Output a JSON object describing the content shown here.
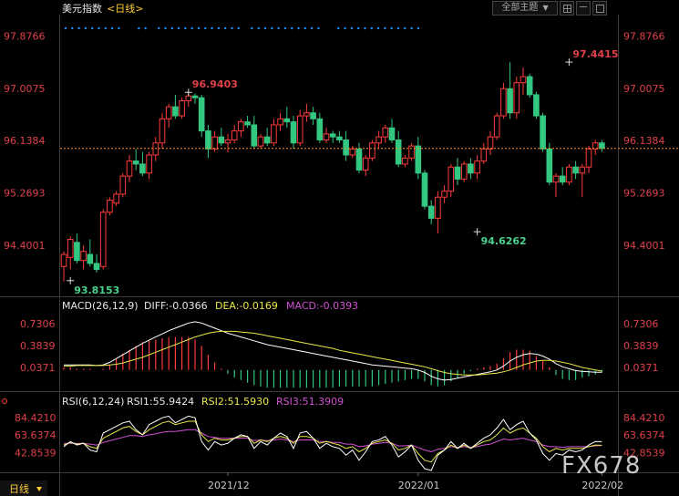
{
  "header": {
    "title": "美元指数",
    "period": "<日线>",
    "dropdown_label": "全部主题",
    "dropdown_arrow": "▼"
  },
  "footer": {
    "period_label": "日线",
    "watermark": "FX678"
  },
  "colors": {
    "up": "#ff3b3b",
    "down": "#32c882",
    "price_label": "#e0404a",
    "diff": "#ffffff",
    "dea": "#e8e84a",
    "macd": "#d050d0",
    "rsi1": "#ffffff",
    "rsi2": "#e8e84a",
    "rsi3": "#d050d0",
    "dots": "#1e90ff",
    "current_line": "#ff9020"
  },
  "chart_data": [
    {
      "type": "candlestick",
      "ylim": [
        93.6,
        98.2
      ],
      "y_ticks": [
        "97.8766",
        "97.0075",
        "96.1384",
        "95.2693",
        "94.4001"
      ],
      "current_price": 96.01,
      "x_ticks": [
        "2021/12",
        "2022/01",
        "2022/02"
      ],
      "x_tick_index": [
        25,
        54,
        82
      ],
      "annotations": [
        {
          "text": "96.9403",
          "index": 19,
          "value": 96.9403
        },
        {
          "text": "97.4415",
          "index": 77,
          "value": 97.4415
        },
        {
          "text": "94.6262",
          "index": 63,
          "value": 94.6262
        },
        {
          "text": "93.8153",
          "index": 1,
          "value": 93.8153
        }
      ],
      "candles": [
        [
          94.05,
          94.3,
          93.8,
          94.25
        ],
        [
          94.2,
          94.55,
          94.0,
          94.5
        ],
        [
          94.45,
          94.6,
          94.1,
          94.15
        ],
        [
          94.15,
          94.4,
          94.0,
          94.3
        ],
        [
          94.25,
          94.5,
          94.05,
          94.1
        ],
        [
          94.1,
          94.25,
          93.95,
          94.0
        ],
        [
          94.05,
          95.0,
          94.0,
          94.95
        ],
        [
          94.95,
          95.2,
          94.9,
          95.15
        ],
        [
          95.1,
          95.3,
          95.05,
          95.25
        ],
        [
          95.25,
          95.6,
          95.2,
          95.55
        ],
        [
          95.55,
          95.9,
          95.45,
          95.8
        ],
        [
          95.8,
          96.0,
          95.65,
          95.75
        ],
        [
          95.75,
          95.95,
          95.55,
          95.6
        ],
        [
          95.6,
          95.95,
          95.5,
          95.9
        ],
        [
          95.9,
          96.2,
          95.8,
          96.1
        ],
        [
          96.1,
          96.6,
          96.0,
          96.5
        ],
        [
          96.5,
          96.75,
          96.35,
          96.7
        ],
        [
          96.7,
          96.9,
          96.5,
          96.55
        ],
        [
          96.55,
          96.85,
          96.5,
          96.8
        ],
        [
          96.8,
          96.95,
          96.7,
          96.88
        ],
        [
          96.88,
          96.92,
          96.75,
          96.85
        ],
        [
          96.85,
          96.9,
          96.2,
          96.3
        ],
        [
          96.3,
          96.4,
          95.85,
          96.0
        ],
        [
          96.0,
          96.3,
          95.95,
          96.2
        ],
        [
          96.2,
          96.35,
          96.05,
          96.1
        ],
        [
          96.1,
          96.25,
          95.95,
          96.15
        ],
        [
          96.15,
          96.4,
          96.1,
          96.3
        ],
        [
          96.3,
          96.5,
          96.2,
          96.45
        ],
        [
          96.45,
          96.55,
          96.35,
          96.4
        ],
        [
          96.4,
          96.55,
          96.0,
          96.05
        ],
        [
          96.05,
          96.25,
          96.0,
          96.2
        ],
        [
          96.2,
          96.35,
          96.05,
          96.1
        ],
        [
          96.1,
          96.5,
          96.05,
          96.4
        ],
        [
          96.4,
          96.6,
          96.3,
          96.5
        ],
        [
          96.5,
          96.7,
          96.35,
          96.45
        ],
        [
          96.45,
          96.55,
          96.0,
          96.1
        ],
        [
          96.1,
          96.65,
          96.05,
          96.55
        ],
        [
          96.55,
          96.75,
          96.45,
          96.6
        ],
        [
          96.6,
          96.7,
          96.4,
          96.5
        ],
        [
          96.5,
          96.6,
          96.1,
          96.15
        ],
        [
          96.15,
          96.35,
          96.1,
          96.25
        ],
        [
          96.25,
          96.3,
          96.1,
          96.2
        ],
        [
          96.2,
          96.3,
          96.1,
          96.15
        ],
        [
          96.15,
          96.3,
          95.8,
          95.9
        ],
        [
          95.9,
          96.05,
          95.85,
          96.0
        ],
        [
          96.0,
          96.1,
          95.6,
          95.65
        ],
        [
          95.65,
          95.9,
          95.55,
          95.85
        ],
        [
          95.85,
          96.15,
          95.8,
          96.1
        ],
        [
          96.1,
          96.3,
          96.0,
          96.2
        ],
        [
          96.2,
          96.4,
          96.1,
          96.35
        ],
        [
          96.35,
          96.5,
          96.1,
          96.15
        ],
        [
          96.15,
          96.3,
          95.7,
          95.75
        ],
        [
          95.75,
          95.9,
          95.7,
          95.85
        ],
        [
          95.85,
          96.1,
          95.8,
          96.05
        ],
        [
          96.05,
          96.2,
          95.5,
          95.6
        ],
        [
          95.6,
          95.65,
          95.0,
          95.05
        ],
        [
          95.05,
          95.15,
          94.75,
          94.85
        ],
        [
          94.85,
          95.3,
          94.6,
          95.2
        ],
        [
          95.2,
          95.4,
          95.1,
          95.3
        ],
        [
          95.3,
          95.75,
          95.2,
          95.7
        ],
        [
          95.7,
          95.85,
          95.4,
          95.5
        ],
        [
          95.5,
          95.8,
          95.45,
          95.75
        ],
        [
          95.75,
          95.85,
          95.5,
          95.6
        ],
        [
          95.6,
          95.9,
          95.5,
          95.8
        ],
        [
          95.8,
          96.1,
          95.75,
          96.0
        ],
        [
          96.0,
          96.3,
          95.9,
          96.2
        ],
        [
          96.2,
          96.6,
          96.15,
          96.55
        ],
        [
          96.55,
          97.1,
          96.5,
          97.0
        ],
        [
          97.0,
          97.44,
          96.5,
          96.6
        ],
        [
          96.6,
          97.2,
          96.5,
          97.1
        ],
        [
          97.1,
          97.35,
          96.9,
          97.2
        ],
        [
          97.2,
          97.25,
          96.85,
          96.9
        ],
        [
          96.9,
          96.95,
          96.5,
          96.55
        ],
        [
          96.55,
          96.6,
          95.95,
          96.0
        ],
        [
          96.0,
          96.1,
          95.4,
          95.45
        ],
        [
          95.45,
          95.6,
          95.2,
          95.55
        ],
        [
          95.55,
          95.7,
          95.4,
          95.45
        ],
        [
          95.45,
          95.75,
          95.4,
          95.7
        ],
        [
          95.7,
          95.8,
          95.5,
          95.6
        ],
        [
          95.6,
          95.75,
          95.2,
          95.7
        ],
        [
          95.7,
          96.05,
          95.6,
          96.0
        ],
        [
          96.0,
          96.15,
          95.9,
          96.1
        ],
        [
          96.1,
          96.15,
          95.95,
          96.01
        ]
      ]
    },
    {
      "type": "line",
      "title": "MACD(26,12,9)",
      "legend": {
        "diff": "DIFF:-0.0366",
        "dea": "DEA:-0.0169",
        "macd": "MACD:-0.0393"
      },
      "ylim": [
        -0.32,
        0.86
      ],
      "y_ticks": [
        "0.7306",
        "0.3839",
        "0.0371"
      ],
      "series": [
        {
          "key": "diff",
          "values": [
            0.08,
            0.08,
            0.08,
            0.08,
            0.08,
            0.07,
            0.08,
            0.12,
            0.18,
            0.24,
            0.3,
            0.36,
            0.42,
            0.47,
            0.52,
            0.57,
            0.62,
            0.66,
            0.7,
            0.74,
            0.76,
            0.74,
            0.7,
            0.66,
            0.62,
            0.58,
            0.55,
            0.52,
            0.49,
            0.46,
            0.43,
            0.4,
            0.38,
            0.36,
            0.34,
            0.32,
            0.3,
            0.28,
            0.26,
            0.24,
            0.22,
            0.2,
            0.18,
            0.16,
            0.14,
            0.12,
            0.1,
            0.08,
            0.07,
            0.06,
            0.05,
            0.04,
            0.03,
            0.02,
            0.0,
            -0.04,
            -0.1,
            -0.14,
            -0.16,
            -0.15,
            -0.13,
            -0.11,
            -0.09,
            -0.07,
            -0.05,
            -0.03,
            0.0,
            0.06,
            0.14,
            0.2,
            0.24,
            0.26,
            0.25,
            0.22,
            0.17,
            0.1,
            0.05,
            0.02,
            -0.01,
            -0.02,
            -0.03,
            -0.035,
            -0.0366
          ]
        },
        {
          "key": "dea",
          "values": [
            0.06,
            0.06,
            0.07,
            0.07,
            0.07,
            0.07,
            0.07,
            0.08,
            0.09,
            0.11,
            0.14,
            0.17,
            0.2,
            0.24,
            0.28,
            0.32,
            0.36,
            0.4,
            0.44,
            0.48,
            0.52,
            0.55,
            0.58,
            0.6,
            0.61,
            0.61,
            0.61,
            0.6,
            0.59,
            0.58,
            0.56,
            0.54,
            0.52,
            0.5,
            0.48,
            0.46,
            0.44,
            0.42,
            0.4,
            0.38,
            0.36,
            0.34,
            0.31,
            0.29,
            0.27,
            0.25,
            0.23,
            0.21,
            0.19,
            0.17,
            0.15,
            0.13,
            0.11,
            0.09,
            0.07,
            0.05,
            0.02,
            -0.01,
            -0.04,
            -0.06,
            -0.07,
            -0.08,
            -0.08,
            -0.08,
            -0.07,
            -0.06,
            -0.05,
            -0.03,
            0.0,
            0.04,
            0.08,
            0.11,
            0.14,
            0.15,
            0.15,
            0.14,
            0.12,
            0.1,
            0.07,
            0.04,
            0.02,
            0.0,
            -0.0169
          ]
        },
        {
          "key": "macd",
          "values": [
            0.04,
            0.04,
            0.02,
            0.02,
            0.02,
            0.0,
            0.02,
            0.08,
            0.18,
            0.26,
            0.32,
            0.38,
            0.44,
            0.46,
            0.48,
            0.5,
            0.52,
            0.52,
            0.52,
            0.52,
            0.48,
            0.38,
            0.24,
            0.12,
            0.02,
            -0.06,
            -0.12,
            -0.16,
            -0.2,
            -0.24,
            -0.26,
            -0.28,
            -0.28,
            -0.28,
            -0.28,
            -0.28,
            -0.28,
            -0.28,
            -0.28,
            -0.28,
            -0.28,
            -0.28,
            -0.26,
            -0.26,
            -0.26,
            -0.26,
            -0.26,
            -0.26,
            -0.24,
            -0.22,
            -0.2,
            -0.18,
            -0.16,
            -0.14,
            -0.14,
            -0.18,
            -0.24,
            -0.26,
            -0.24,
            -0.18,
            -0.12,
            -0.06,
            -0.02,
            0.02,
            0.04,
            0.06,
            0.1,
            0.18,
            0.28,
            0.32,
            0.32,
            0.3,
            0.22,
            0.14,
            0.04,
            -0.08,
            -0.14,
            -0.16,
            -0.16,
            -0.12,
            -0.1,
            -0.07,
            -0.0393
          ]
        }
      ]
    },
    {
      "type": "line",
      "title": "RSI(6,12,24)",
      "legend": {
        "rsi1": "RSI1:55.9424",
        "rsi2": "RSI2:51.5930",
        "rsi3": "RSI3:51.3909"
      },
      "ylim": [
        22,
        95
      ],
      "y_ticks": [
        "84.4210",
        "63.6374",
        "42.8539"
      ],
      "series": [
        {
          "key": "rsi1",
          "values": [
            50,
            56,
            52,
            54,
            46,
            44,
            66,
            70,
            74,
            78,
            80,
            70,
            64,
            76,
            80,
            84,
            86,
            78,
            82,
            86,
            84,
            56,
            46,
            56,
            52,
            54,
            60,
            64,
            62,
            48,
            56,
            52,
            60,
            66,
            62,
            48,
            66,
            68,
            60,
            48,
            54,
            50,
            48,
            40,
            46,
            34,
            44,
            56,
            58,
            62,
            52,
            38,
            44,
            52,
            34,
            24,
            22,
            40,
            46,
            56,
            48,
            54,
            48,
            54,
            60,
            64,
            72,
            82,
            70,
            76,
            80,
            66,
            58,
            42,
            34,
            42,
            40,
            46,
            44,
            46,
            52,
            56,
            55.9424
          ]
        },
        {
          "key": "rsi2",
          "values": [
            52,
            55,
            53,
            54,
            50,
            48,
            60,
            64,
            68,
            72,
            74,
            68,
            64,
            70,
            74,
            78,
            80,
            76,
            78,
            80,
            80,
            64,
            56,
            60,
            58,
            58,
            60,
            62,
            62,
            54,
            58,
            56,
            60,
            62,
            60,
            54,
            62,
            62,
            60,
            54,
            56,
            54,
            52,
            48,
            50,
            44,
            48,
            54,
            56,
            58,
            54,
            46,
            48,
            52,
            42,
            34,
            32,
            42,
            46,
            52,
            48,
            52,
            48,
            52,
            56,
            58,
            64,
            72,
            66,
            70,
            72,
            66,
            60,
            50,
            44,
            48,
            46,
            48,
            48,
            48,
            50,
            52,
            51.593
          ]
        },
        {
          "key": "rsi3",
          "values": [
            54,
            54,
            54,
            54,
            53,
            52,
            55,
            57,
            59,
            61,
            63,
            63,
            62,
            64,
            65,
            67,
            68,
            68,
            69,
            70,
            70,
            66,
            62,
            61,
            60,
            60,
            60,
            60,
            60,
            57,
            58,
            57,
            58,
            59,
            58,
            56,
            58,
            58,
            58,
            56,
            56,
            55,
            55,
            53,
            53,
            50,
            51,
            53,
            54,
            55,
            54,
            51,
            51,
            52,
            49,
            46,
            44,
            47,
            48,
            50,
            49,
            50,
            49,
            50,
            52,
            53,
            56,
            59,
            58,
            59,
            60,
            58,
            56,
            52,
            50,
            50,
            49,
            50,
            50,
            50,
            50,
            51,
            51.3909
          ]
        }
      ]
    }
  ]
}
